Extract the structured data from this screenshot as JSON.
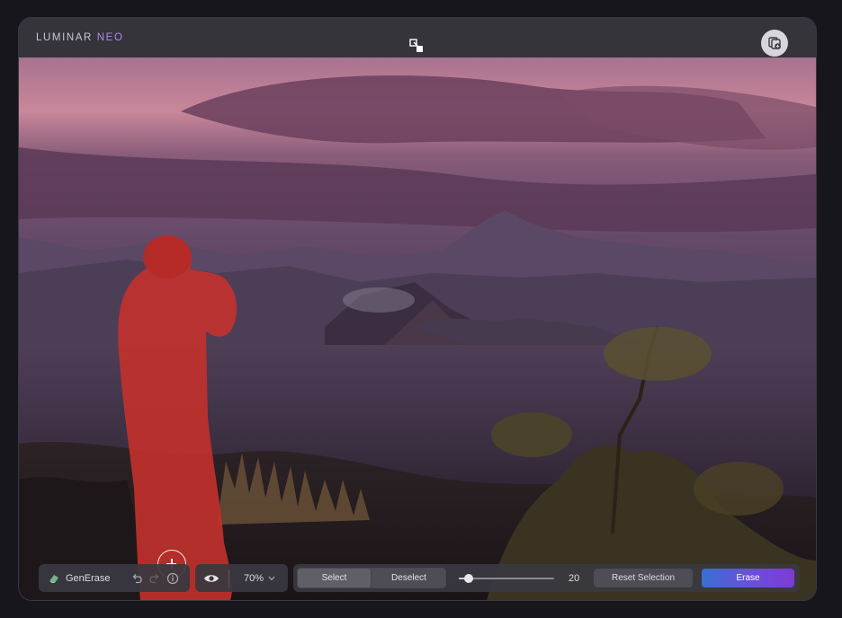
{
  "app": {
    "brand_main": "LUMINAR",
    "brand_accent": "NEO",
    "brand_accent_color": "#b487e8"
  },
  "topbar": {
    "compare_icon": "compare-icon",
    "account_icon": "layers-plus-icon"
  },
  "toolbar": {
    "tool_icon": "eraser-icon",
    "tool_name": "GenErase",
    "undo_icon": "undo-icon",
    "redo_icon": "redo-icon",
    "info_icon": "info-icon",
    "visibility_icon": "eye-icon",
    "zoom_value": "70%",
    "select_label": "Select",
    "deselect_label": "Deselect",
    "brush_size": "20",
    "brush_size_fraction": 0.1,
    "reset_label": "Reset Selection",
    "erase_label": "Erase",
    "erase_color": "#6a4fd8"
  }
}
